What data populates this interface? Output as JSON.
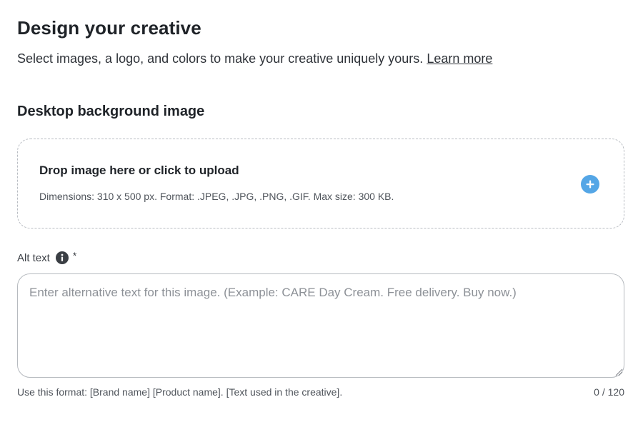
{
  "header": {
    "title": "Design your creative",
    "subtitle": "Select images, a logo, and colors to make your creative uniquely yours.",
    "learn_more": "Learn more"
  },
  "desktop_background": {
    "title": "Desktop background image",
    "dropzone_title": "Drop image here or click to upload",
    "dropzone_hint": "Dimensions: 310 x 500 px. Format: .JPEG, .JPG, .PNG, .GIF. Max size: 300 KB.",
    "upload_icon": "plus-circle-icon",
    "accent_color": "#54a6e6"
  },
  "alt_text": {
    "label": "Alt text",
    "required_mark": "*",
    "info_icon": "info-icon",
    "value": "",
    "placeholder": "Enter alternative text for this image. (Example: CARE Day Cream. Free delivery. Buy now.)",
    "helper": "Use this format: [Brand name] [Product name]. [Text used in the creative].",
    "counter": "0 / 120"
  }
}
